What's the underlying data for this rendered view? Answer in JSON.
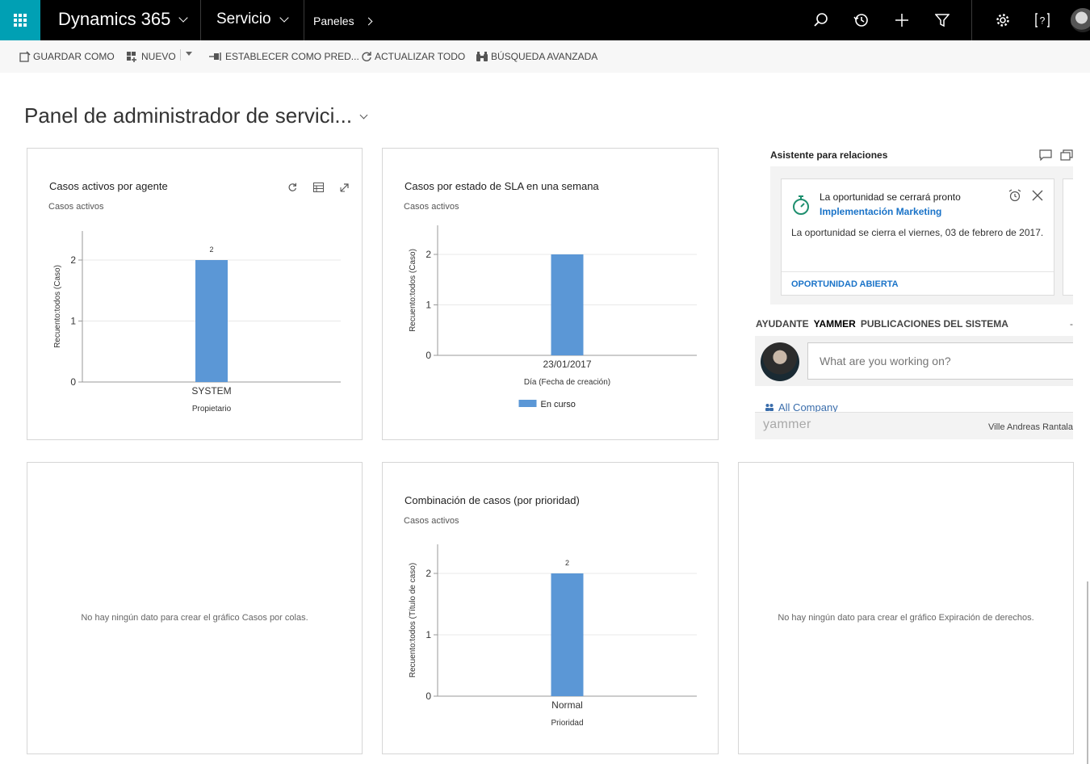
{
  "nav": {
    "brand": "Dynamics 365",
    "module": "Servicio",
    "breadcrumb": "Paneles",
    "icons": [
      "search-icon",
      "history-icon",
      "plus-icon",
      "filter-icon",
      "gear-icon",
      "help-icon"
    ]
  },
  "commands": {
    "save_as": "GUARDAR COMO",
    "new": "NUEVO",
    "set_default": "ESTABLECER COMO PRED...",
    "refresh_all": "ACTUALIZAR TODO",
    "advanced_find": "BÚSQUEDA AVANZADA"
  },
  "dashboard": {
    "title": "Panel de administrador de servici..."
  },
  "panels": {
    "agent": {
      "title": "Casos activos por agente",
      "view": "Casos activos"
    },
    "sla": {
      "title": "Casos por estado de SLA en una semana",
      "view": "Casos activos"
    },
    "queues": {
      "message": "No hay ningún dato para crear el gráfico Casos por colas."
    },
    "priority": {
      "title": "Combinación de casos (por prioridad)",
      "view": "Casos activos"
    },
    "entitlement": {
      "message": "No hay ningún dato para crear el gráfico Expiración de derechos."
    }
  },
  "chart_data": [
    {
      "type": "bar",
      "categories": [
        "SYSTEM"
      ],
      "values": [
        2
      ],
      "data_labels": [
        "2"
      ],
      "xlabel": "Propietario",
      "ylabel": "Recuento:todos (Caso)",
      "ylim": [
        0,
        2
      ],
      "yticks": [
        0,
        1,
        2
      ],
      "color": "#5b97d6",
      "grid": true
    },
    {
      "type": "bar",
      "categories": [
        "23/01/2017"
      ],
      "series": [
        {
          "name": "En curso",
          "values": [
            2
          ]
        }
      ],
      "xlabel": "Día (Fecha de creación)",
      "ylabel": "Recuento:todos (Caso)",
      "ylim": [
        0,
        2
      ],
      "yticks": [
        0,
        1,
        2
      ],
      "color": "#5b97d6",
      "legend": "bottom",
      "grid": true
    },
    {
      "type": "bar",
      "categories": [
        "Normal"
      ],
      "values": [
        2
      ],
      "data_labels": [
        "2"
      ],
      "xlabel": "Prioridad",
      "ylabel": "Recuento:todos (Título de caso)",
      "ylim": [
        0,
        2
      ],
      "yticks": [
        0,
        1,
        2
      ],
      "color": "#5b97d6",
      "grid": true
    }
  ],
  "assistant": {
    "title": "Asistente para relaciones",
    "card": {
      "title": "La oportunidad se cerrará pronto",
      "link": "Implementación Marketing",
      "description": "La oportunidad se cierra el viernes, 03 de febrero de 2017.",
      "action": "OPORTUNIDAD ABIERTA"
    }
  },
  "yammer": {
    "tabs": [
      "AYUDANTE",
      "YAMMER",
      "PUBLICACIONES DEL SISTEMA"
    ],
    "active_tab": "YAMMER",
    "dash": "-",
    "placeholder": "What are you working on?",
    "group": "All Company",
    "logo": "yammer",
    "user": "Ville Andreas Rantala"
  }
}
